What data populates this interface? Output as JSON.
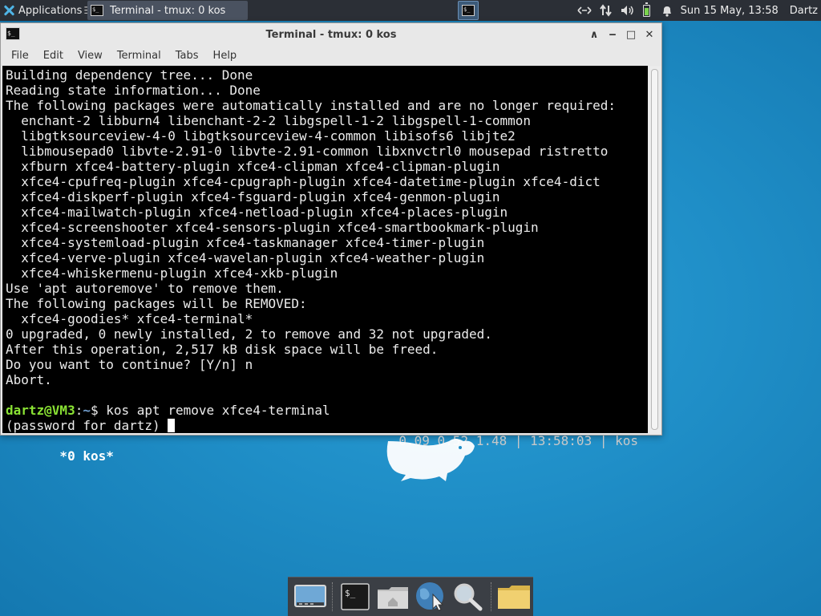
{
  "top_panel": {
    "apps_label": "Applications",
    "apps_separator": "☰",
    "task_title": "Terminal - tmux: 0 kos",
    "clock": "Sun 15 May, 13:58",
    "user": "Dartz",
    "tray_icons": [
      "network-icon",
      "transfer-icon",
      "volume-icon",
      "battery-icon",
      "notifications-icon"
    ]
  },
  "window": {
    "title": "Terminal - tmux: 0 kos",
    "controls": {
      "shade": "∧",
      "minimize": "‒",
      "maximize": "□",
      "close": "✕"
    },
    "menu": [
      "File",
      "Edit",
      "View",
      "Terminal",
      "Tabs",
      "Help"
    ]
  },
  "terminal": {
    "lines": [
      "Building dependency tree... Done",
      "Reading state information... Done",
      "The following packages were automatically installed and are no longer required:",
      "  enchant-2 libburn4 libenchant-2-2 libgspell-1-2 libgspell-1-common",
      "  libgtksourceview-4-0 libgtksourceview-4-common libisofs6 libjte2",
      "  libmousepad0 libvte-2.91-0 libvte-2.91-common libxnvctrl0 mousepad ristretto",
      "  xfburn xfce4-battery-plugin xfce4-clipman xfce4-clipman-plugin",
      "  xfce4-cpufreq-plugin xfce4-cpugraph-plugin xfce4-datetime-plugin xfce4-dict",
      "  xfce4-diskperf-plugin xfce4-fsguard-plugin xfce4-genmon-plugin",
      "  xfce4-mailwatch-plugin xfce4-netload-plugin xfce4-places-plugin",
      "  xfce4-screenshooter xfce4-sensors-plugin xfce4-smartbookmark-plugin",
      "  xfce4-systemload-plugin xfce4-taskmanager xfce4-timer-plugin",
      "  xfce4-verve-plugin xfce4-wavelan-plugin xfce4-weather-plugin",
      "  xfce4-whiskermenu-plugin xfce4-xkb-plugin",
      "Use 'apt autoremove' to remove them.",
      "The following packages will be REMOVED:",
      "  xfce4-goodies* xfce4-terminal*",
      "0 upgraded, 0 newly installed, 2 to remove and 32 not upgraded.",
      "After this operation, 2,517 kB disk space will be freed.",
      "Do you want to continue? [Y/n] n",
      "Abort."
    ],
    "prompt": {
      "user_host": "dartz@VM3",
      "colon": ":",
      "path": "~",
      "symbol": "$",
      "command": " kos apt remove xfce4-terminal"
    },
    "password_prompt": "(password for dartz) ",
    "status_left": " *0 kos*",
    "status_right": "0.09 0.52 1.48 | 13:58:03 | kos"
  },
  "dock": {
    "items": [
      "show-desktop",
      "terminal",
      "home-folder",
      "web-browser",
      "app-finder",
      "files"
    ]
  },
  "colors": {
    "panel_bg": "#2b2f36",
    "desktop_bg": "#1f8ec7",
    "prompt_user": "#8ae234",
    "prompt_path": "#729fcf"
  }
}
